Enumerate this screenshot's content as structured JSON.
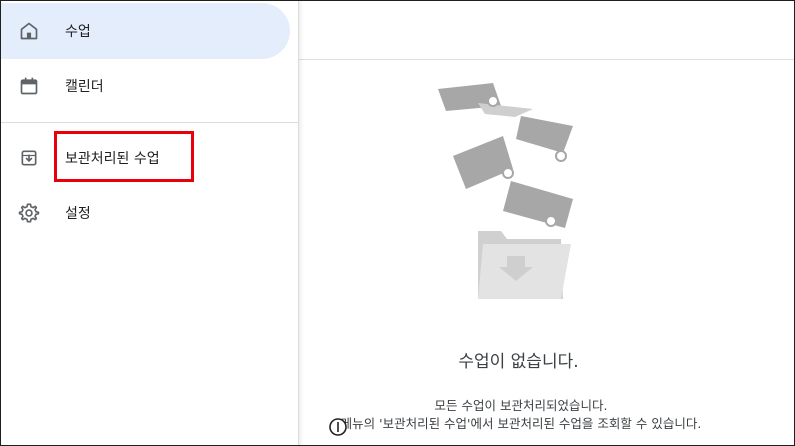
{
  "drawer": {
    "items": [
      {
        "label": "수업",
        "icon": "home-icon",
        "active": true
      },
      {
        "label": "캘린더",
        "icon": "calendar-icon",
        "active": false
      },
      {
        "label": "보관처리된 수업",
        "icon": "archive-icon",
        "active": false
      },
      {
        "label": "설정",
        "icon": "gear-icon",
        "active": false
      }
    ]
  },
  "empty_state": {
    "title": "수업이 없습니다.",
    "line1": "모든 수업이 보관처리되었습니다.",
    "line2": "메뉴의 '보관처리된 수업'에서 보관처리된 수업을 조회할 수 있습니다.",
    "illustration": "archived-classes-illustration"
  },
  "colors": {
    "active_bg": "#e3edfc",
    "highlight": "#e8000b",
    "icon": "#5f6368",
    "illustration": "#9e9e9e"
  }
}
